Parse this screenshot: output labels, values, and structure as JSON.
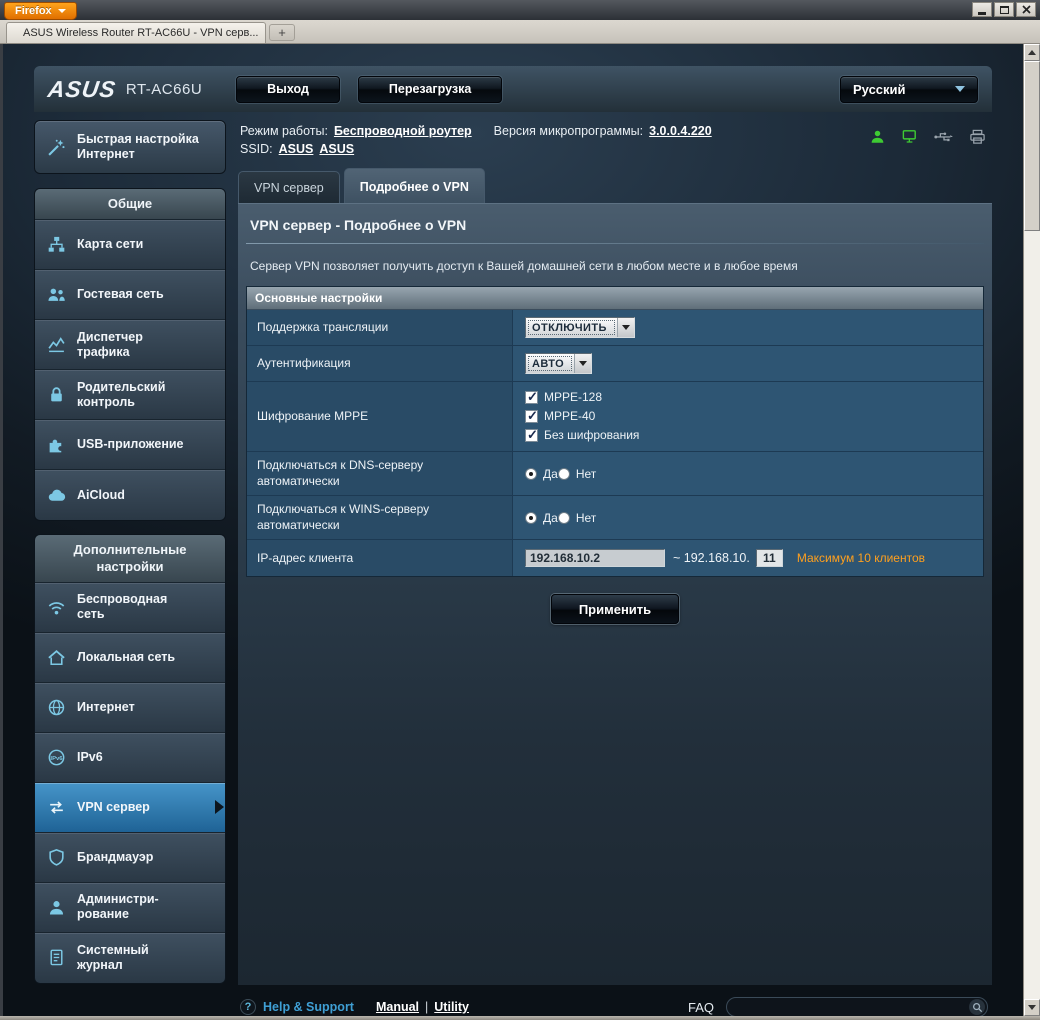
{
  "colors": {
    "accent_orange": "#FF9900",
    "active_item_blue": "#2F81B7",
    "status_green": "#3ECB33",
    "help_link_blue": "#3F9FD4"
  },
  "window": {
    "firefox_button": "Firefox",
    "tab_title": "ASUS Wireless Router RT-AC66U - VPN серв...",
    "new_tab_label": "+"
  },
  "header": {
    "brand": "ASUS",
    "model": "RT-AC66U",
    "logout_label": "Выход",
    "reboot_label": "Перезагрузка",
    "language": "Русский"
  },
  "info": {
    "mode_label": "Режим работы:",
    "mode_value": "Беспроводной роутер",
    "firmware_label": "Версия микропрограммы:",
    "firmware_value": "3.0.0.4.220",
    "ssid_label": "SSID:",
    "ssid_values": [
      "ASUS",
      "ASUS"
    ]
  },
  "status_icons": [
    "clients-icon",
    "network-monitor-icon",
    "usb-icon",
    "printer-icon"
  ],
  "tabs": [
    {
      "label": "VPN сервер",
      "active": false
    },
    {
      "label": "Подробнее о VPN",
      "active": true
    }
  ],
  "sidebar": {
    "quick_setup_label": "Быстрая настройка\nИнтернет",
    "general": {
      "title": "Общие",
      "items": [
        {
          "label": "Карта сети",
          "icon": "network-map-icon"
        },
        {
          "label": "Гостевая сеть",
          "icon": "guest-network-icon"
        },
        {
          "label": "Диспетчер\nтрафика",
          "icon": "traffic-manager-icon"
        },
        {
          "label": "Родительский\nконтроль",
          "icon": "parental-control-icon"
        },
        {
          "label": "USB-приложение",
          "icon": "usb-application-icon"
        },
        {
          "label": "AiCloud",
          "icon": "aicloud-icon"
        }
      ]
    },
    "advanced": {
      "title": "Дополнительные\nнастройки",
      "items": [
        {
          "label": "Беспроводная\nсеть",
          "icon": "wireless-icon"
        },
        {
          "label": "Локальная сеть",
          "icon": "lan-icon"
        },
        {
          "label": "Интернет",
          "icon": "internet-icon"
        },
        {
          "label": "IPv6",
          "icon": "ipv6-icon"
        },
        {
          "label": "VPN сервер",
          "icon": "vpn-icon",
          "active": true
        },
        {
          "label": "Брандмауэр",
          "icon": "firewall-icon"
        },
        {
          "label": "Администри-\nрование",
          "icon": "administration-icon"
        },
        {
          "label": "Системный\nжурнал",
          "icon": "system-log-icon"
        }
      ]
    }
  },
  "page": {
    "title": "VPN сервер - Подробнее о VPN",
    "description": "Сервер VPN позволяет получить доступ к Вашей домашней сети в любом месте и в любое время"
  },
  "settings": {
    "section_title": "Основные настройки",
    "broadcast_label": "Поддержка трансляции",
    "broadcast_value": "ОТКЛЮЧИТЬ",
    "auth_label": "Аутентификация",
    "auth_value": "АВТО",
    "mppe_label": "Шифрование MPPE",
    "mppe_options": [
      {
        "label": "MPPE-128",
        "checked": true
      },
      {
        "label": "MPPE-40",
        "checked": true
      },
      {
        "label": "Без шифрования",
        "checked": true
      }
    ],
    "dns_label": "Подключаться к DNS-серверу автоматически",
    "wins_label": "Подключаться к WINS-серверу автоматически",
    "radio_yes": "Да",
    "radio_no": "Нет",
    "client_ip_label": "IP-адрес клиента",
    "client_ip_start": "192.168.10.2",
    "client_ip_separator": "~ 192.168.10.",
    "client_ip_end": "11",
    "client_ip_note": "Максимум 10 клиентов",
    "apply_label": "Применить"
  },
  "footer": {
    "help_icon": "?",
    "help_label": "Help & Support",
    "manual_label": "Manual",
    "separator": "|",
    "utility_label": "Utility",
    "faq_label": "FAQ"
  }
}
